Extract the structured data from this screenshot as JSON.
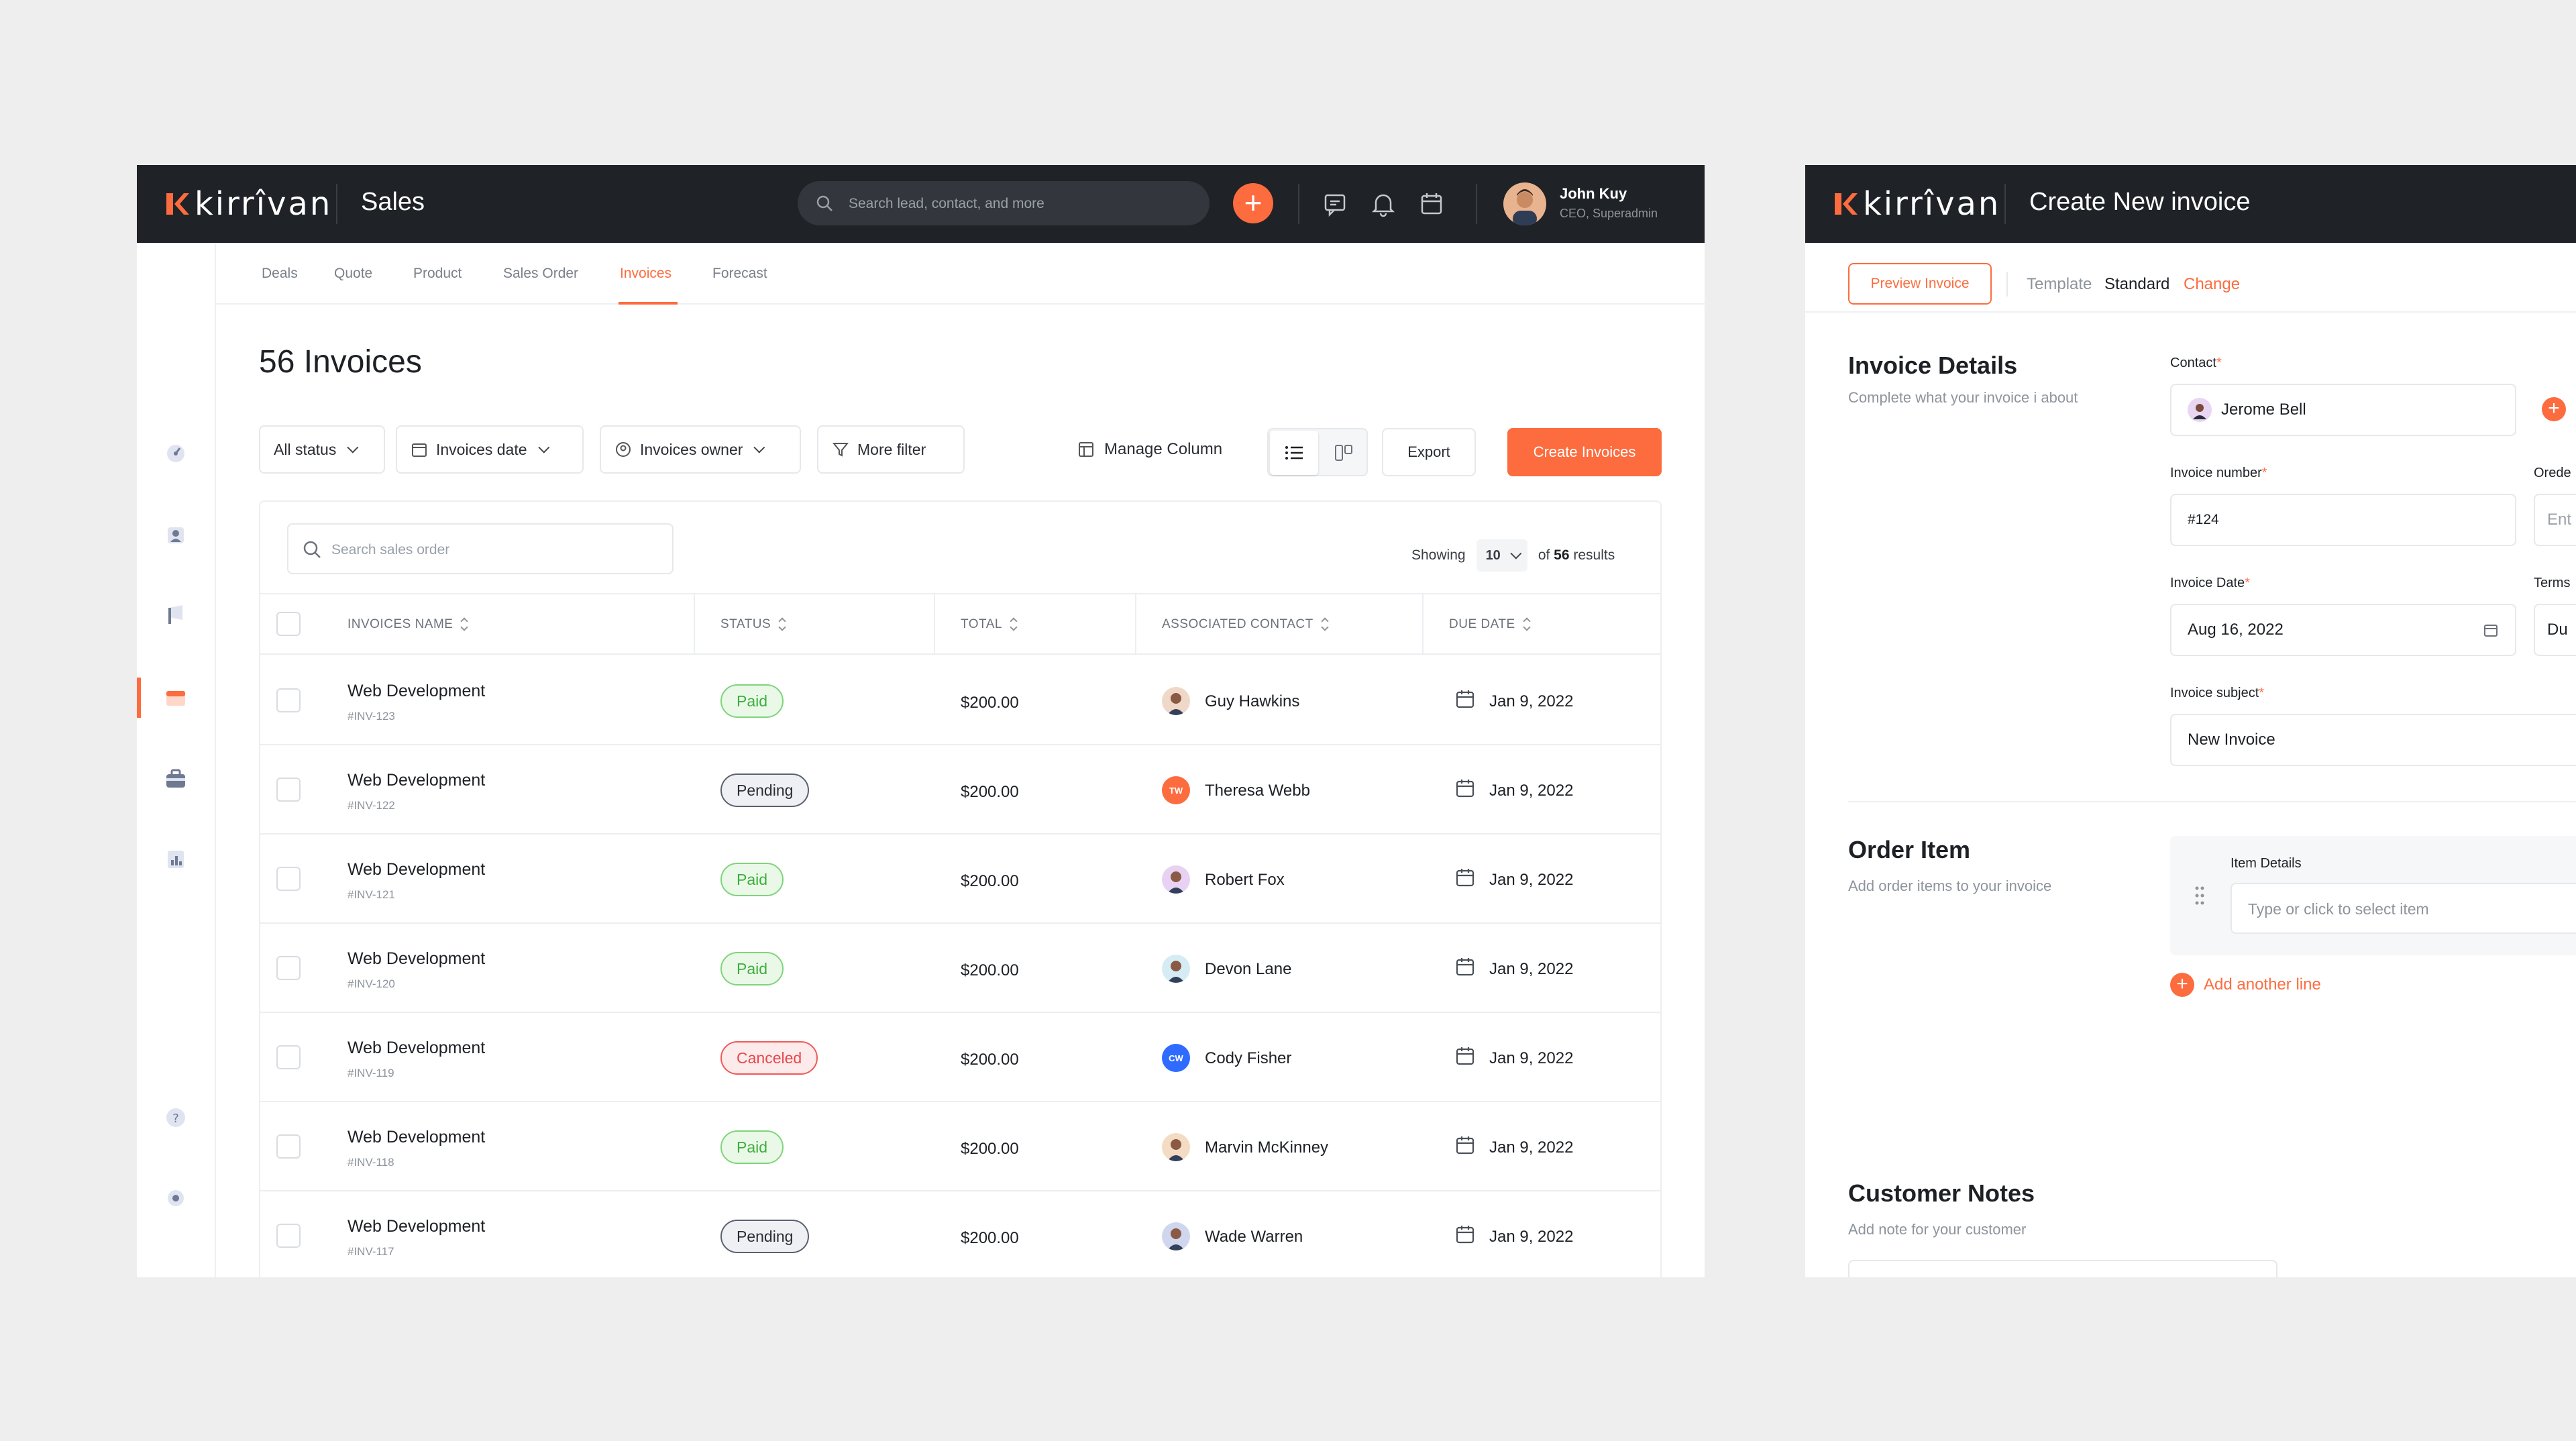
{
  "colors": {
    "accent": "#fc6c3f",
    "topbar": "#1f2226",
    "paid": "#3cae3c",
    "canceled": "#e5484d"
  },
  "left": {
    "brand": "kirrîvan",
    "app_title": "Sales",
    "search_placeholder": "Search lead, contact, and more",
    "user": {
      "name": "John Kuy",
      "role": "CEO, Superadmin"
    },
    "tabs": [
      {
        "label": "Deals"
      },
      {
        "label": "Quote"
      },
      {
        "label": "Product"
      },
      {
        "label": "Sales Order"
      },
      {
        "label": "Invoices",
        "active": true
      },
      {
        "label": "Forecast"
      }
    ],
    "page_title": "56 Invoices",
    "filters": {
      "status": "All status",
      "date": "Invoices date",
      "owner": "Invoices owner",
      "more": "More filter"
    },
    "toolbar": {
      "manage_column": "Manage Column",
      "export": "Export",
      "create": "Create Invoices"
    },
    "table": {
      "search_placeholder": "Search sales order",
      "showing_label": "Showing",
      "page_size": "10",
      "results_prefix": "of",
      "results_count": "56",
      "results_suffix": "results",
      "columns": [
        "INVOICES NAME",
        "STATUS",
        "TOTAL",
        "ASSOCIATED CONTACT",
        "DUE DATE"
      ],
      "rows": [
        {
          "name": "Web Development",
          "id": "#INV-123",
          "status": "Paid",
          "total": "$200.00",
          "contact": "Guy Hawkins",
          "due": "Jan 9, 2022"
        },
        {
          "name": "Web Development",
          "id": "#INV-122",
          "status": "Pending",
          "total": "$200.00",
          "contact": "Theresa Webb",
          "initials": "TW",
          "due": "Jan 9, 2022"
        },
        {
          "name": "Web Development",
          "id": "#INV-121",
          "status": "Paid",
          "total": "$200.00",
          "contact": "Robert Fox",
          "due": "Jan 9, 2022"
        },
        {
          "name": "Web Development",
          "id": "#INV-120",
          "status": "Paid",
          "total": "$200.00",
          "contact": "Devon Lane",
          "due": "Jan 9, 2022"
        },
        {
          "name": "Web Development",
          "id": "#INV-119",
          "status": "Canceled",
          "total": "$200.00",
          "contact": "Cody Fisher",
          "initials": "CW",
          "due": "Jan 9, 2022"
        },
        {
          "name": "Web Development",
          "id": "#INV-118",
          "status": "Paid",
          "total": "$200.00",
          "contact": "Marvin McKinney",
          "due": "Jan 9, 2022"
        },
        {
          "name": "Web Development",
          "id": "#INV-117",
          "status": "Pending",
          "total": "$200.00",
          "contact": "Wade Warren",
          "due": "Jan 9, 2022"
        }
      ]
    }
  },
  "right": {
    "brand": "kirrîvan",
    "title": "Create New invoice",
    "preview_button": "Preview Invoice",
    "template_label": "Template",
    "template_value": "Standard",
    "template_change": "Change",
    "invoice_details": {
      "title": "Invoice Details",
      "subtitle": "Complete what your invoice i about",
      "contact_label": "Contact",
      "contact_value": "Jerome Bell",
      "number_label": "Invoice number",
      "number_value": "#124",
      "order_label": "Orede",
      "order_placeholder": "Ent",
      "date_label": "Invoice Date",
      "date_value": "Aug 16, 2022",
      "terms_label": "Terms",
      "terms_value": "Du",
      "subject_label": "Invoice subject",
      "subject_value": "New Invoice"
    },
    "order_item": {
      "title": "Order Item",
      "subtitle": "Add order items to your invoice",
      "item_label": "Item Details",
      "item_placeholder": "Type or click to select item",
      "add_line": "Add another line"
    },
    "customer_notes": {
      "title": "Customer Notes",
      "subtitle": "Add note for your customer"
    }
  }
}
